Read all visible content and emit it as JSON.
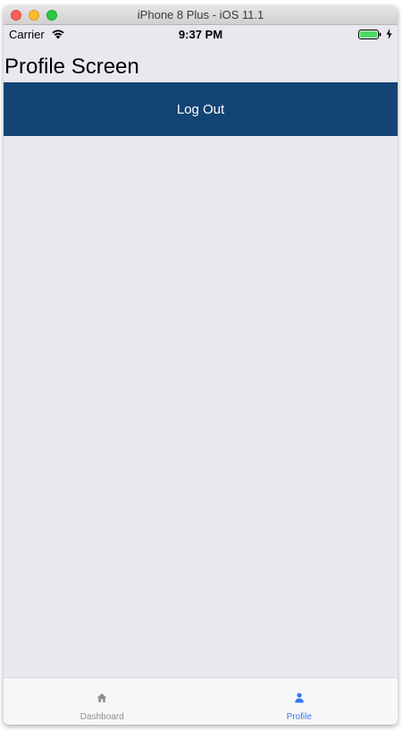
{
  "window": {
    "title": "iPhone 8 Plus - iOS 11.1"
  },
  "status_bar": {
    "carrier": "Carrier",
    "time": "9:37 PM",
    "wifi_icon": "wifi-icon",
    "battery_icon": "battery-icon",
    "charging_icon": "bolt-icon",
    "battery_level": 1.0,
    "battery_color": "#4cd964"
  },
  "screen": {
    "title": "Profile Screen",
    "logout_label": "Log Out",
    "logout_color": "#134473",
    "background_color": "#e9e8ef"
  },
  "tab_bar": {
    "tabs": [
      {
        "label": "Dashboard",
        "icon": "home-icon",
        "active": false
      },
      {
        "label": "Profile",
        "icon": "user-icon",
        "active": true
      }
    ],
    "active_color": "#3478f6",
    "inactive_color": "#8e8e8e"
  }
}
